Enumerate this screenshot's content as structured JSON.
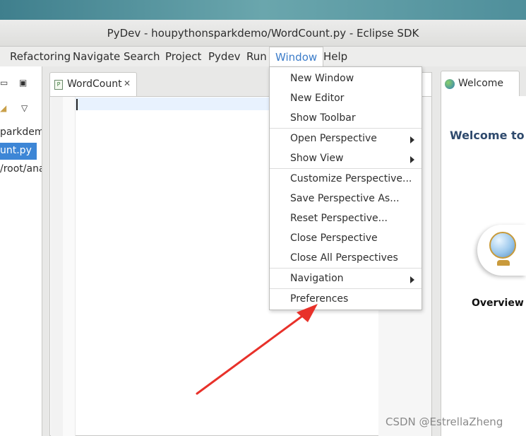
{
  "window": {
    "title": "PyDev - houpythonsparkdemo/WordCount.py - Eclipse SDK"
  },
  "menubar": {
    "items": [
      "Refactoring",
      "Navigate",
      "Search",
      "Project",
      "Pydev",
      "Run",
      "Window",
      "Help"
    ],
    "active": "Window"
  },
  "explorer": {
    "rows": [
      "parkdem",
      "unt.py",
      "/root/ana"
    ]
  },
  "editor": {
    "tab_label": "WordCount",
    "close_glyph": "✕"
  },
  "welcome": {
    "tab_label": "Welcome",
    "heading": "Welcome to",
    "overview_label": "Overview"
  },
  "window_menu": {
    "items": [
      {
        "label": "New Window",
        "submenu": false
      },
      {
        "label": "New Editor",
        "submenu": false
      },
      {
        "label": "Show Toolbar",
        "submenu": false
      },
      {
        "label": "Open Perspective",
        "submenu": true
      },
      {
        "label": "Show View",
        "submenu": true
      },
      {
        "label": "Customize Perspective...",
        "submenu": false
      },
      {
        "label": "Save Perspective As...",
        "submenu": false
      },
      {
        "label": "Reset Perspective...",
        "submenu": false
      },
      {
        "label": "Close Perspective",
        "submenu": false
      },
      {
        "label": "Close All Perspectives",
        "submenu": false
      },
      {
        "label": "Navigation",
        "submenu": true
      },
      {
        "label": "Preferences",
        "submenu": false
      }
    ]
  },
  "annotation": {
    "arrow_color": "#e8312a"
  },
  "watermark": "CSDN @EstrellaZheng",
  "colors": {
    "accent": "#3b7cc9",
    "selection": "#3d86d6",
    "welcome_heading": "#2f4a6d"
  }
}
